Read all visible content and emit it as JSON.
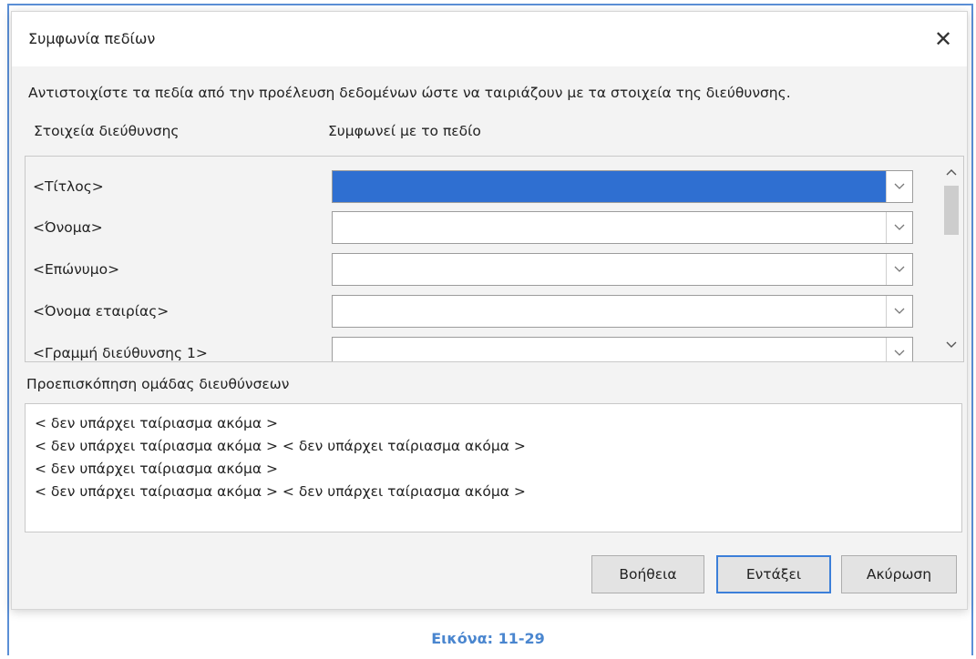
{
  "dialog": {
    "title": "Συμφωνία πεδίων",
    "close_label": "✕",
    "instruction": "Αντιστοιχίστε τα πεδία από την προέλευση δεδομένων ώστε να ταιριάζουν με τα στοιχεία της διεύθυνσης.",
    "column_headers": {
      "address_elements": "Στοιχεία διεύθυνσης",
      "matches_field": "Συμφωνεί με το πεδίο"
    },
    "fields": [
      {
        "label": "<Τίτλος>",
        "value": "",
        "selected": true
      },
      {
        "label": "<Όνομα>",
        "value": "",
        "selected": false
      },
      {
        "label": "<Επώνυμο>",
        "value": "",
        "selected": false
      },
      {
        "label": "<Όνομα εταιρίας>",
        "value": "",
        "selected": false
      },
      {
        "label": "<Γραμμή διεύθυνσης 1>",
        "value": "",
        "selected": false
      }
    ],
    "preview_label": "Προεπισκόπηση ομάδας διευθύνσεων",
    "preview_lines": [
      "< δεν υπάρχει ταίριασμα ακόμα >",
      "< δεν υπάρχει ταίριασμα ακόμα > < δεν υπάρχει ταίριασμα ακόμα >",
      "< δεν υπάρχει ταίριασμα ακόμα >",
      "< δεν υπάρχει ταίριασμα ακόμα > < δεν υπάρχει ταίριασμα ακόμα >"
    ],
    "buttons": {
      "help": "Βοήθεια",
      "ok": "Εντάξει",
      "cancel": "Ακύρωση"
    }
  },
  "caption": "Εικόνα: 11-29",
  "colors": {
    "selection": "#2f6fd1",
    "caption": "#4a86cf",
    "default_button_border": "#3c7fd9"
  },
  "icons": {
    "close": "close-icon",
    "dropdown": "chevron-down-icon",
    "scroll_up": "chevron-up-icon",
    "scroll_down": "chevron-down-icon"
  }
}
